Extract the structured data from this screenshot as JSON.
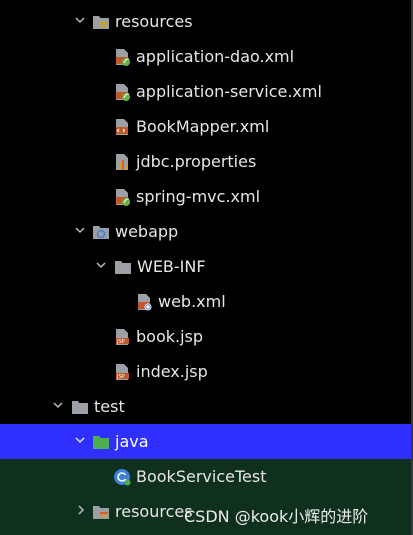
{
  "tree": {
    "nodes": [
      {
        "label": "resources",
        "icon": "resources-folder-icon"
      },
      {
        "label": "application-dao.xml",
        "icon": "spring-xml-icon"
      },
      {
        "label": "application-service.xml",
        "icon": "spring-xml-icon"
      },
      {
        "label": "BookMapper.xml",
        "icon": "mybatis-xml-icon"
      },
      {
        "label": "jdbc.properties",
        "icon": "properties-icon"
      },
      {
        "label": "spring-mvc.xml",
        "icon": "spring-xml-icon"
      },
      {
        "label": "webapp",
        "icon": "web-folder-icon"
      },
      {
        "label": "WEB-INF",
        "icon": "folder-icon"
      },
      {
        "label": "web.xml",
        "icon": "web-xml-icon"
      },
      {
        "label": "book.jsp",
        "icon": "jsp-icon"
      },
      {
        "label": "index.jsp",
        "icon": "jsp-icon"
      },
      {
        "label": "test",
        "icon": "folder-icon"
      },
      {
        "label": "java",
        "icon": "test-source-folder-icon"
      },
      {
        "label": "BookServiceTest",
        "icon": "java-class-icon"
      },
      {
        "label": "resources",
        "icon": "test-resources-folder-icon"
      }
    ]
  },
  "watermark": "CSDN @kook小辉的进阶",
  "colors": {
    "selected_row": "#2f2fff",
    "test_scope_bg": "#10301e",
    "background": "#000000",
    "text": "#e6e6e6"
  }
}
